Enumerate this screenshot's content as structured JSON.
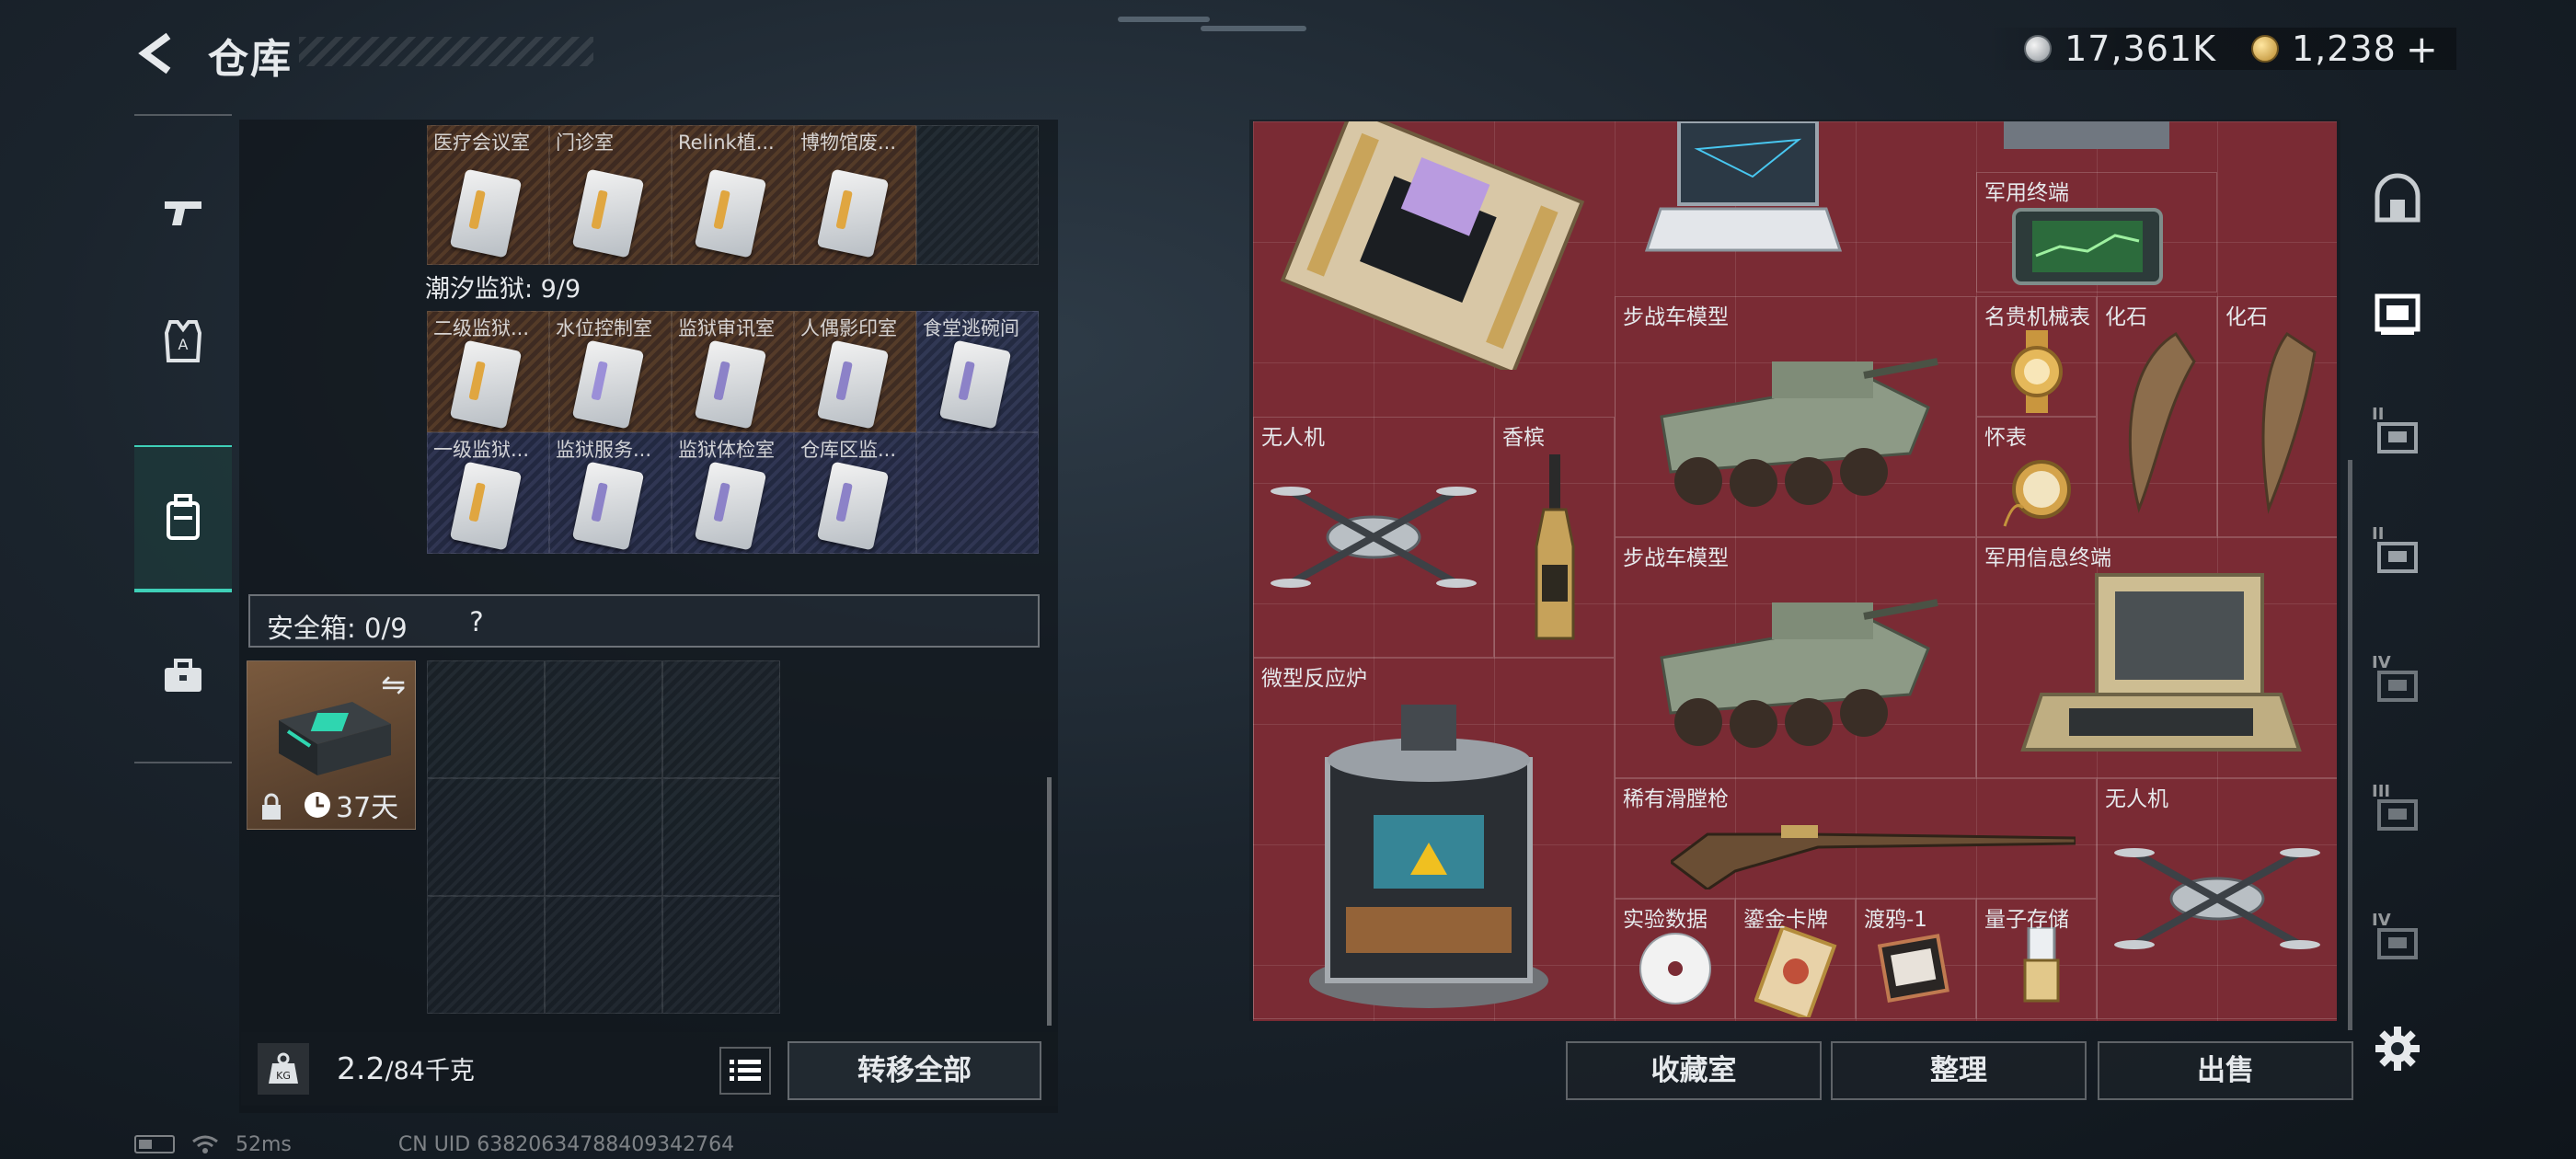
{
  "header": {
    "title": "仓库",
    "currencies": [
      {
        "icon": "silver-coin-icon",
        "value": "17,361K"
      },
      {
        "icon": "gold-coin-icon",
        "value": "1,238"
      }
    ],
    "add_label": "+"
  },
  "nav": {
    "items": [
      {
        "name": "weapons",
        "icon": "pistol-icon"
      },
      {
        "name": "armor",
        "icon": "vest-icon"
      },
      {
        "name": "backpack",
        "icon": "backpack-icon",
        "active": true
      },
      {
        "name": "toolbox",
        "icon": "briefcase-icon"
      }
    ]
  },
  "keycards_top": {
    "row": [
      {
        "label": "医疗会议室",
        "color": "orange"
      },
      {
        "label": "门诊室",
        "color": "orange"
      },
      {
        "label": "Relink植...",
        "color": "orange"
      },
      {
        "label": "博物馆废...",
        "color": "orange"
      },
      {
        "label": "",
        "color": "dark"
      }
    ]
  },
  "tidal_prison": {
    "title": "潮汐监狱: 9/9",
    "row1": [
      {
        "label": "二级监狱...",
        "color": "orange",
        "stripe": "#e0a640"
      },
      {
        "label": "水位控制室",
        "color": "orange",
        "stripe": "#9b8fd8"
      },
      {
        "label": "监狱审讯室",
        "color": "orange",
        "stripe": "#8c82c8"
      },
      {
        "label": "人偶影印室",
        "color": "orange",
        "stripe": "#8c82c8"
      },
      {
        "label": "食堂逃碗间",
        "color": "blue",
        "stripe": "#8c82c8"
      }
    ],
    "row2": [
      {
        "label": "一级监狱...",
        "color": "blue",
        "stripe": "#e0a640"
      },
      {
        "label": "监狱服务...",
        "color": "blue",
        "stripe": "#8c82c8"
      },
      {
        "label": "监狱体检室",
        "color": "blue",
        "stripe": "#8c82c8"
      },
      {
        "label": "仓库区监...",
        "color": "blue",
        "stripe": "#8c82c8"
      },
      {
        "label": "",
        "color": "blue"
      }
    ]
  },
  "safebox": {
    "label": "安全箱: 0/9",
    "help": "?",
    "item_timer": "37天"
  },
  "weight": {
    "current": "2.2",
    "max": "/84千克",
    "transfer_label": "转移全部"
  },
  "warehouse": {
    "items": [
      {
        "id": "motherboard",
        "name": ""
      },
      {
        "id": "laptop",
        "name": ""
      },
      {
        "id": "gpu",
        "name": ""
      },
      {
        "id": "military-terminal",
        "name": "军用终端"
      },
      {
        "id": "ifv-model-1",
        "name": "步战车模型"
      },
      {
        "id": "luxury-watch",
        "name": "名贵机械表"
      },
      {
        "id": "fossil-1",
        "name": "化石"
      },
      {
        "id": "fossil-2",
        "name": "化石"
      },
      {
        "id": "drone-1",
        "name": "无人机"
      },
      {
        "id": "champagne",
        "name": "香槟"
      },
      {
        "id": "pocket-watch",
        "name": "怀表"
      },
      {
        "id": "ifv-model-2",
        "name": "步战车模型"
      },
      {
        "id": "military-info-terminal",
        "name": "军用信息终端"
      },
      {
        "id": "micro-reactor",
        "name": "微型反应炉"
      },
      {
        "id": "rare-musket",
        "name": "稀有滑膛枪"
      },
      {
        "id": "drone-2",
        "name": "无人机"
      },
      {
        "id": "experiment-data",
        "name": "实验数据"
      },
      {
        "id": "gilded-tarot",
        "name": "鎏金卡牌"
      },
      {
        "id": "raven-1",
        "name": "渡鸦-1"
      },
      {
        "id": "quantum-storage",
        "name": "量子存储"
      }
    ]
  },
  "actions": {
    "collection": "收藏室",
    "organize": "整理",
    "sell": "出售"
  },
  "status": {
    "ping": "52ms",
    "uid": "CN UID 6382063478840934276​4"
  },
  "colors": {
    "accent": "#3fd0b8",
    "warehouse_bg": "#7a2b34",
    "panel_bg": "#10161c"
  }
}
